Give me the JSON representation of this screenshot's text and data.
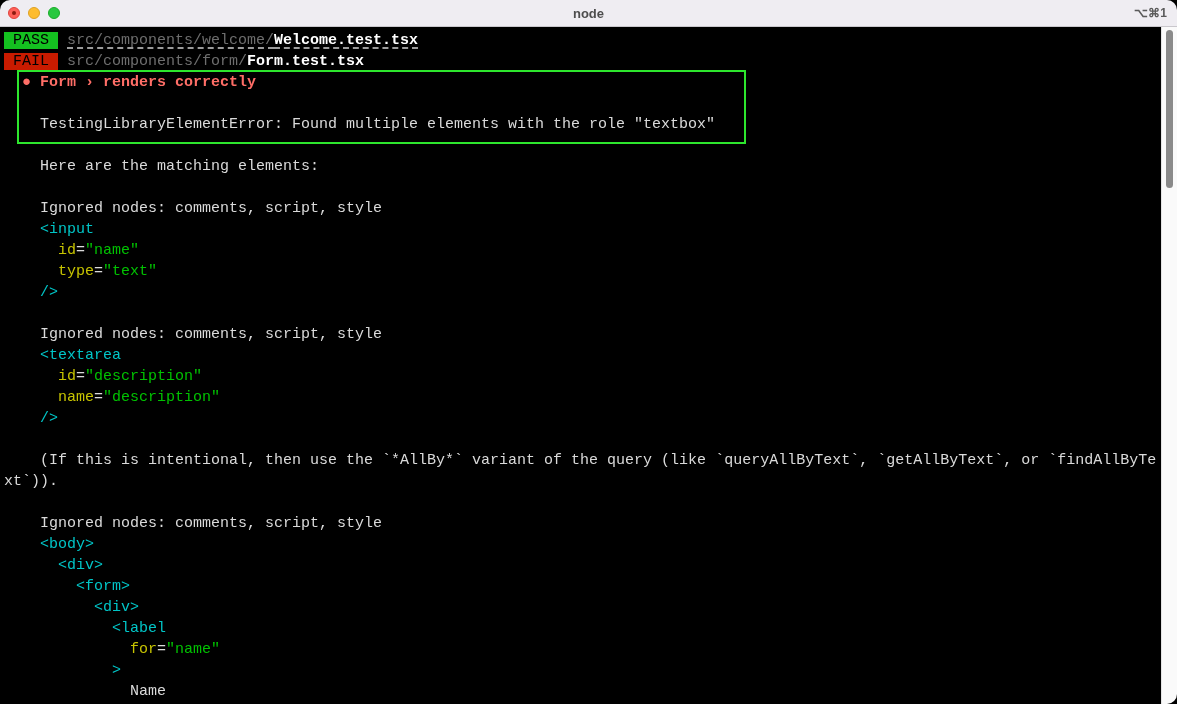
{
  "window": {
    "title": "node",
    "shortcut": "⌥⌘1"
  },
  "blocks": [
    {
      "kind": "plain",
      "lines": [
        {
          "kind": "text",
          "segments": [
            {
              "kind": "badge_pass",
              "text": "PASS"
            },
            {
              "kind": "path",
              "text": " src/components/welcome/",
              "underlined": true
            },
            {
              "kind": "file",
              "text": "Welcome.test.tsx",
              "underlined": true
            }
          ]
        },
        {
          "kind": "text",
          "segments": [
            {
              "kind": "badge_fail",
              "text": "FAIL"
            },
            {
              "kind": "path",
              "text": " src/components/form/"
            },
            {
              "kind": "file",
              "text": "Form.test.tsx"
            }
          ]
        }
      ]
    },
    {
      "kind": "framed",
      "lines": [
        {
          "kind": "text",
          "segments": [
            {
              "kind": "bullet",
              "text": "  ●"
            },
            {
              "kind": "title",
              "text": " Form › renders correctly"
            }
          ]
        },
        {
          "kind": "blank"
        },
        {
          "kind": "text",
          "segments": [
            {
              "kind": "plain",
              "text": "    TestingLibraryElementError: Found multiple elements with the role \"textbox\""
            }
          ]
        }
      ]
    },
    {
      "kind": "plain",
      "lines": [
        {
          "kind": "blank"
        },
        {
          "kind": "text",
          "segments": [
            {
              "kind": "plain",
              "text": "    Here are the matching elements:"
            }
          ]
        },
        {
          "kind": "blank"
        },
        {
          "kind": "text",
          "segments": [
            {
              "kind": "plain",
              "text": "    Ignored nodes: comments, script, style"
            }
          ]
        },
        {
          "kind": "text",
          "segments": [
            {
              "kind": "tag",
              "text": "    <input"
            }
          ]
        },
        {
          "kind": "text",
          "segments": [
            {
              "kind": "attr",
              "text": "      id"
            },
            {
              "kind": "plain",
              "text": "="
            },
            {
              "kind": "string",
              "text": "\"name\""
            }
          ]
        },
        {
          "kind": "text",
          "segments": [
            {
              "kind": "attr",
              "text": "      type"
            },
            {
              "kind": "plain",
              "text": "="
            },
            {
              "kind": "string",
              "text": "\"text\""
            }
          ]
        },
        {
          "kind": "text",
          "segments": [
            {
              "kind": "tag",
              "text": "    />"
            }
          ]
        },
        {
          "kind": "blank"
        },
        {
          "kind": "text",
          "segments": [
            {
              "kind": "plain",
              "text": "    Ignored nodes: comments, script, style"
            }
          ]
        },
        {
          "kind": "text",
          "segments": [
            {
              "kind": "tag",
              "text": "    <textarea"
            }
          ]
        },
        {
          "kind": "text",
          "segments": [
            {
              "kind": "attr",
              "text": "      id"
            },
            {
              "kind": "plain",
              "text": "="
            },
            {
              "kind": "string",
              "text": "\"description\""
            }
          ]
        },
        {
          "kind": "text",
          "segments": [
            {
              "kind": "attr",
              "text": "      name"
            },
            {
              "kind": "plain",
              "text": "="
            },
            {
              "kind": "string",
              "text": "\"description\""
            }
          ]
        },
        {
          "kind": "text",
          "segments": [
            {
              "kind": "tag",
              "text": "    />"
            }
          ]
        },
        {
          "kind": "blank"
        },
        {
          "kind": "text",
          "segments": [
            {
              "kind": "plain",
              "text": "    (If this is intentional, then use the `*AllBy*` variant of the query (like `queryAllByText`, `getAllByText`, or `findAllByTe"
            }
          ]
        },
        {
          "kind": "text",
          "segments": [
            {
              "kind": "plain",
              "text": "xt`))."
            }
          ]
        },
        {
          "kind": "blank"
        },
        {
          "kind": "text",
          "segments": [
            {
              "kind": "plain",
              "text": "    Ignored nodes: comments, script, style"
            }
          ]
        },
        {
          "kind": "text",
          "segments": [
            {
              "kind": "tag",
              "text": "    <body>"
            }
          ]
        },
        {
          "kind": "text",
          "segments": [
            {
              "kind": "tag",
              "text": "      <div>"
            }
          ]
        },
        {
          "kind": "text",
          "segments": [
            {
              "kind": "tag",
              "text": "        <form>"
            }
          ]
        },
        {
          "kind": "text",
          "segments": [
            {
              "kind": "tag",
              "text": "          <div>"
            }
          ]
        },
        {
          "kind": "text",
          "segments": [
            {
              "kind": "tag",
              "text": "            <label"
            }
          ]
        },
        {
          "kind": "text",
          "segments": [
            {
              "kind": "attr",
              "text": "              for"
            },
            {
              "kind": "plain",
              "text": "="
            },
            {
              "kind": "string",
              "text": "\"name\""
            }
          ]
        },
        {
          "kind": "text",
          "segments": [
            {
              "kind": "tag",
              "text": "            >"
            }
          ]
        },
        {
          "kind": "text",
          "segments": [
            {
              "kind": "plain",
              "text": "              Name"
            }
          ]
        }
      ]
    }
  ]
}
